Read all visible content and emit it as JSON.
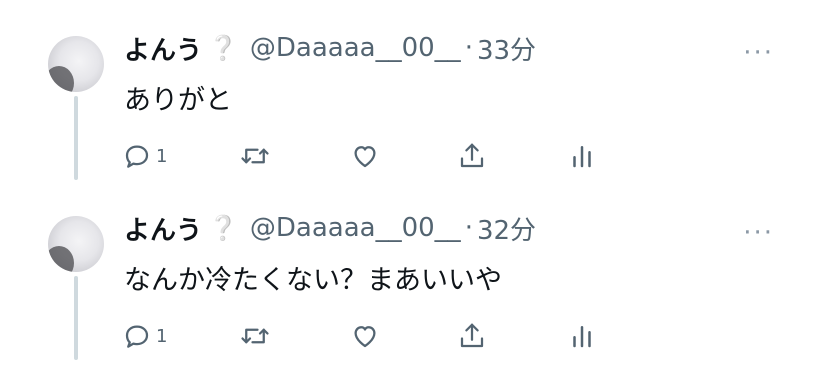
{
  "tweets": [
    {
      "name": "よんう",
      "badge": "❔",
      "handle": "@Daaaaa__00__",
      "separator": "·",
      "time": "33分",
      "text": "ありがと",
      "reply_count": "1"
    },
    {
      "name": "よんう",
      "badge": "❔",
      "handle": "@Daaaaa__00__",
      "separator": "·",
      "time": "32分",
      "text": "なんか冷たくない？まあいいや",
      "reply_count": "1"
    }
  ],
  "more_label": "···",
  "icons": [
    "reply-icon",
    "retweet-icon",
    "like-icon",
    "share-icon",
    "analytics-icon"
  ],
  "colors": {
    "text": "#0f1419",
    "secondary": "#536471",
    "thread_line": "#cfd9de"
  }
}
